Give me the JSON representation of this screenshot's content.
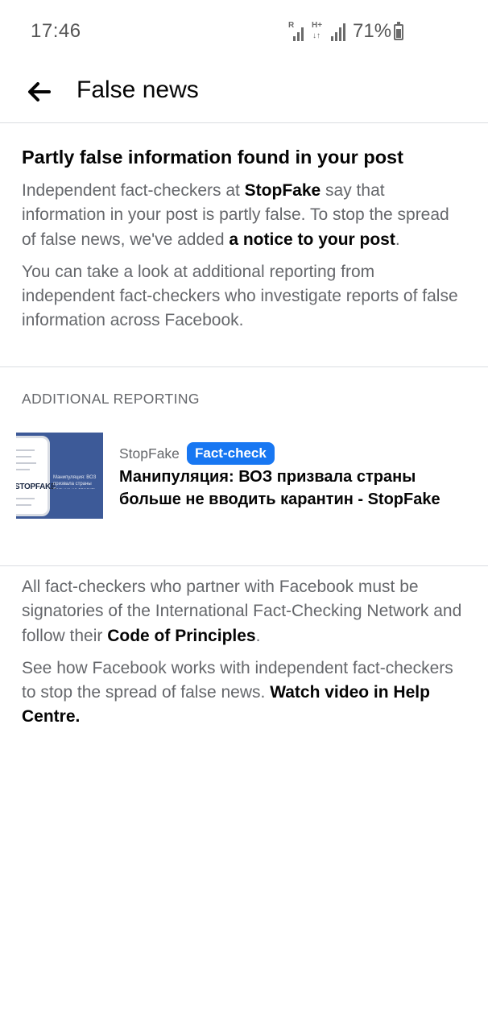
{
  "status_bar": {
    "time": "17:46",
    "signal1_tag": "R",
    "signal2_tag": "H+",
    "battery_percent": "71%"
  },
  "header": {
    "back_icon": "arrow-left-icon",
    "title": "False news"
  },
  "notice": {
    "heading": "Partly false information found in your post",
    "para1_part1": "Independent fact-checkers at ",
    "para1_strong1": "StopFake",
    "para1_part2": " say that information in your post is partly false. To stop the spread of false news, we've added ",
    "para1_strong2": "a notice to your post",
    "para1_part3": ".",
    "para2": "You can take a look at additional reporting from independent fact-checkers who investigate reports of false information across Facebook."
  },
  "additional_reporting": {
    "caption": "ADDITIONAL REPORTING",
    "article": {
      "thumbnail_logo": "STOPFAKE",
      "thumbnail_text": "Манипуляция: ВОЗ призвала страны больше не вводить карантин",
      "source": "StopFake",
      "badge": "Fact-check",
      "title": "Манипуляция: ВОЗ призвала страны больше не вводить карантин - StopFake"
    }
  },
  "footer": {
    "para1_part1": "All fact-checkers who partner with Facebook must be signatories of the International Fact-Checking Network and follow their ",
    "para1_link": "Code of Principles",
    "para1_part2": ".",
    "para2_part1": "See how Facebook works with independent fact-checkers to stop the spread of false news. ",
    "para2_link": "Watch video in Help Centre."
  },
  "colors": {
    "badge": "#1877f2",
    "text_primary": "#050505",
    "text_secondary": "#65676b",
    "thumbnail_bg": "#3d5a98"
  }
}
